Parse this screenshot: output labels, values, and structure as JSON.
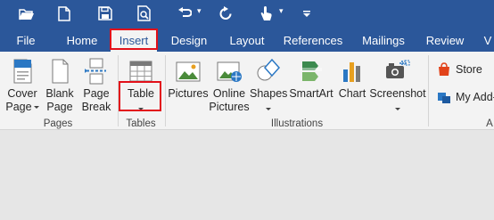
{
  "quick_access": {
    "icons": [
      "open-folder-icon",
      "new-document-icon",
      "save-icon",
      "print-preview-icon",
      "undo-icon",
      "redo-icon",
      "touch-mode-icon",
      "customize-icon"
    ]
  },
  "tabs": [
    {
      "label": "File"
    },
    {
      "label": "Home"
    },
    {
      "label": "Insert",
      "active": true
    },
    {
      "label": "Design"
    },
    {
      "label": "Layout"
    },
    {
      "label": "References"
    },
    {
      "label": "Mailings"
    },
    {
      "label": "Review"
    },
    {
      "label": "V"
    }
  ],
  "ribbon": {
    "pages": {
      "group_label": "Pages",
      "cover_line1": "Cover",
      "cover_line2": "Page",
      "blank_line1": "Blank",
      "blank_line2": "Page",
      "break_line1": "Page",
      "break_line2": "Break"
    },
    "tables": {
      "group_label": "Tables",
      "table_label": "Table"
    },
    "illustrations": {
      "group_label": "Illustrations",
      "pictures_label": "Pictures",
      "online_line1": "Online",
      "online_line2": "Pictures",
      "shapes_label": "Shapes",
      "smartart_label": "SmartArt",
      "chart_label": "Chart",
      "screenshot_label": "Screenshot"
    },
    "addins": {
      "store_label": "Store",
      "myaddins_label": "My Add-",
      "group_label_partial": "A"
    }
  },
  "colors": {
    "title_bar": "#2b579a",
    "ribbon_bg": "#f3f3f3",
    "highlight_box": "#e2101a",
    "document_bg": "#e6e6e6"
  }
}
